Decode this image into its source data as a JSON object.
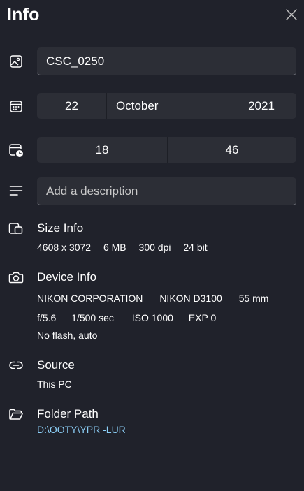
{
  "header": {
    "title": "Info"
  },
  "name_field": {
    "value": "CSC_0250"
  },
  "date": {
    "day": "22",
    "month": "October",
    "year": "2021"
  },
  "time": {
    "hour": "18",
    "minute": "46"
  },
  "description": {
    "placeholder": "Add a description"
  },
  "size_info": {
    "heading": "Size Info",
    "dimensions": "4608 x 3072",
    "file_size": "6 MB",
    "resolution": "300 dpi",
    "bit_depth": "24 bit"
  },
  "device_info": {
    "heading": "Device Info",
    "manufacturer": "NIKON CORPORATION",
    "model": "NIKON D3100",
    "focal_length": "55 mm",
    "aperture": "f/5.6",
    "shutter": "1/500 sec",
    "iso": "ISO 1000",
    "exposure": "EXP 0",
    "flash": "No flash, auto"
  },
  "source": {
    "heading": "Source",
    "value": "This PC"
  },
  "folder": {
    "heading": "Folder Path",
    "path": "D:\\OOTY\\YPR -LUR"
  },
  "icons": {
    "close": "close-icon",
    "image": "image-icon",
    "calendar": "calendar-icon",
    "clock": "calendar-clock-icon",
    "description": "text-lines-icon",
    "size": "size-info-icon",
    "camera": "camera-icon",
    "link": "link-icon",
    "folder": "folder-icon"
  },
  "colors": {
    "background": "#20222b",
    "field": "#2c2e36",
    "link": "#8ccff7"
  }
}
